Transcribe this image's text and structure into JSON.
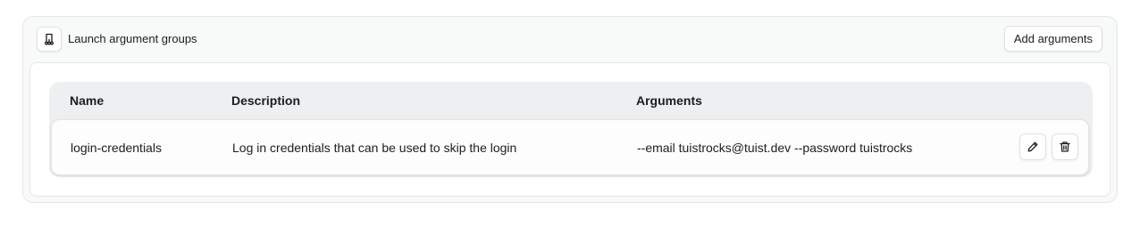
{
  "section": {
    "title": "Launch argument groups",
    "icon": "launch-args-icon",
    "add_button_label": "Add arguments"
  },
  "table": {
    "columns": [
      "Name",
      "Description",
      "Arguments"
    ],
    "rows": [
      {
        "name": "login-credentials",
        "description": "Log in credentials that can be used to skip the login",
        "arguments": "--email tuistrocks@tuist.dev --password tuistrocks",
        "actions": [
          "edit-icon",
          "trash-icon"
        ]
      }
    ]
  }
}
